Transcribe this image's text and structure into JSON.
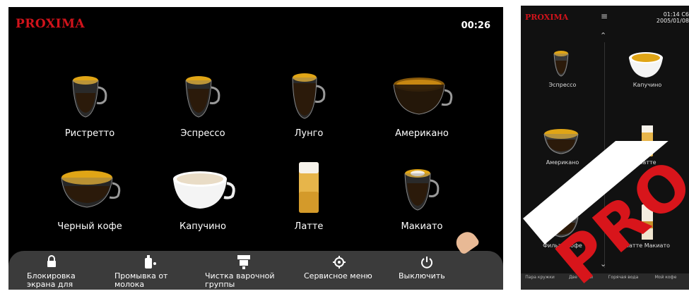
{
  "brand": "PROXIMA",
  "clock": "00:26",
  "drinks": [
    {
      "label": "Ристретто",
      "cup": "glass",
      "fill": "#d8a01a"
    },
    {
      "label": "Эспрессо",
      "cup": "glass",
      "fill": "#e0a516"
    },
    {
      "label": "Лунго",
      "cup": "glass-tall",
      "fill": "#e0a516"
    },
    {
      "label": "Американо",
      "cup": "glass-wide",
      "fill": "#b07a10"
    },
    {
      "label": "Черный кофе",
      "cup": "glass-wide",
      "fill": "#d69a14"
    },
    {
      "label": "Капучино",
      "cup": "white",
      "fill": "#f2e8d8"
    },
    {
      "label": "Латте",
      "cup": "latte",
      "fill": "#e7b54a"
    },
    {
      "label": "Макиато",
      "cup": "glass",
      "fill": "#e0a516"
    }
  ],
  "bottom_bar": [
    {
      "icon": "lock-icon",
      "label": "Блокировка экрана для"
    },
    {
      "icon": "milk-rinse-icon",
      "label": "Промывка от молока"
    },
    {
      "icon": "brew-group-icon",
      "label": "Чистка варочной группы"
    },
    {
      "icon": "gear-icon",
      "label": "Сервисное меню"
    },
    {
      "icon": "power-icon",
      "label": "Выключить"
    }
  ],
  "side_screen": {
    "brand": "PROXIMA",
    "menu_icon": "hamburger-icon",
    "time": "01:14",
    "temp": "C6",
    "date": "2005/01/08",
    "drinks": [
      "Эспрессо",
      "Капучино",
      "Американо",
      "Латте",
      "Фильтр кофе",
      "Латте Макиато"
    ],
    "bottom": [
      "Пара кружки",
      "Две чашки",
      "Горячая вода",
      "Мой кофе"
    ]
  },
  "watermark": "PRO",
  "colors": {
    "brand_red": "#d1131b",
    "coffee_gold": "#e0a516",
    "bar_bg": "#3b3b3b"
  }
}
